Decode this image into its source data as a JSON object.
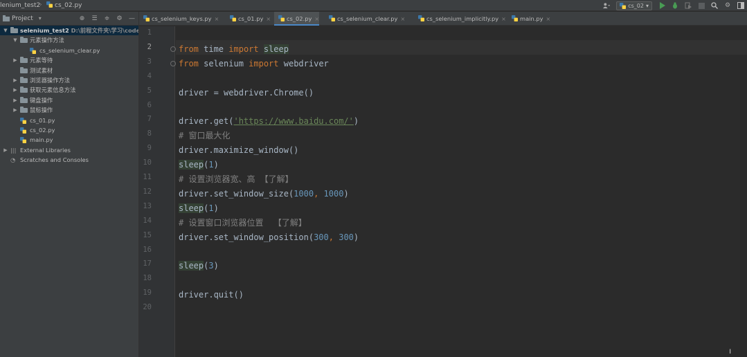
{
  "topbar": {
    "project_crumb": "lenium_test2",
    "file_crumb": "cs_02.py",
    "run_config": "cs_02",
    "icons": [
      "user-icon",
      "run-icon",
      "debug-icon",
      "coverage-icon",
      "stop-icon",
      "search-icon",
      "settings-icon",
      "window-icon"
    ]
  },
  "project_panel": {
    "title": "Project",
    "tree": [
      {
        "label": "selenium_test2",
        "path": "D:\\前程文件夹\\学习\\code\\",
        "type": "root",
        "expanded": true
      },
      {
        "label": "元素操作方法",
        "type": "folder",
        "expanded": true
      },
      {
        "label": "cs_selenium_clear.py",
        "type": "file"
      },
      {
        "label": "元素等待",
        "type": "folder",
        "expanded": false
      },
      {
        "label": "测试素材",
        "type": "folder-leaf"
      },
      {
        "label": "浏览器操作方法",
        "type": "folder",
        "expanded": false
      },
      {
        "label": "获取元素信息方法",
        "type": "folder",
        "expanded": false
      },
      {
        "label": "键盘操作",
        "type": "folder",
        "expanded": false
      },
      {
        "label": "鼠标操作",
        "type": "folder",
        "expanded": false
      },
      {
        "label": "cs_01.py",
        "type": "file"
      },
      {
        "label": "cs_02.py",
        "type": "file"
      },
      {
        "label": "main.py",
        "type": "file"
      },
      {
        "label": "External Libraries",
        "type": "lib",
        "expanded": false
      },
      {
        "label": "Scratches and Consoles",
        "type": "scratch"
      }
    ]
  },
  "tabs": [
    {
      "label": "cs_selenium_keys.py",
      "active": false
    },
    {
      "label": "cs_01.py",
      "active": false
    },
    {
      "label": "cs_02.py",
      "active": true
    },
    {
      "label": "cs_selenium_clear.py",
      "active": false
    },
    {
      "label": "cs_selenium_implicitly.py",
      "active": false
    },
    {
      "label": "main.py",
      "active": false
    }
  ],
  "editor": {
    "current_line": 2,
    "lines": [
      {
        "n": "1",
        "tokens": []
      },
      {
        "n": "2",
        "tokens": [
          {
            "t": "from",
            "c": "kw"
          },
          {
            "t": " time "
          },
          {
            "t": "import",
            "c": "kw"
          },
          {
            "t": " "
          },
          {
            "t": "sleep",
            "c": "hl"
          }
        ]
      },
      {
        "n": "3",
        "tokens": [
          {
            "t": "from",
            "c": "kw"
          },
          {
            "t": " selenium "
          },
          {
            "t": "import",
            "c": "kw"
          },
          {
            "t": " webdriver"
          }
        ]
      },
      {
        "n": "4",
        "tokens": []
      },
      {
        "n": "5",
        "tokens": [
          {
            "t": "driver = webdriver.Chrome()"
          }
        ]
      },
      {
        "n": "6",
        "tokens": []
      },
      {
        "n": "7",
        "tokens": [
          {
            "t": "driver.get("
          },
          {
            "t": "'https://www.baidu.com/'",
            "c": "str"
          },
          {
            "t": ")"
          }
        ]
      },
      {
        "n": "8",
        "tokens": [
          {
            "t": "# 窗口最大化",
            "c": "cmt"
          }
        ]
      },
      {
        "n": "9",
        "tokens": [
          {
            "t": "driver.maximize_window()"
          }
        ]
      },
      {
        "n": "10",
        "tokens": [
          {
            "t": "sleep",
            "c": "hl"
          },
          {
            "t": "("
          },
          {
            "t": "1",
            "c": "num"
          },
          {
            "t": ")"
          }
        ]
      },
      {
        "n": "11",
        "tokens": [
          {
            "t": "# 设置浏览器宽、高 【了解】",
            "c": "cmt"
          }
        ]
      },
      {
        "n": "12",
        "tokens": [
          {
            "t": "driver.set_window_size("
          },
          {
            "t": "1000",
            "c": "num"
          },
          {
            "t": ", ",
            "c": "kw"
          },
          {
            "t": "1000",
            "c": "num"
          },
          {
            "t": ")"
          }
        ]
      },
      {
        "n": "13",
        "tokens": [
          {
            "t": "sleep",
            "c": "hl"
          },
          {
            "t": "("
          },
          {
            "t": "1",
            "c": "num"
          },
          {
            "t": ")"
          }
        ]
      },
      {
        "n": "14",
        "tokens": [
          {
            "t": "# 设置窗口浏览器位置  【了解】",
            "c": "cmt"
          }
        ]
      },
      {
        "n": "15",
        "tokens": [
          {
            "t": "driver.set_window_position("
          },
          {
            "t": "300",
            "c": "num"
          },
          {
            "t": ", ",
            "c": "kw"
          },
          {
            "t": "300",
            "c": "num"
          },
          {
            "t": ")"
          }
        ]
      },
      {
        "n": "16",
        "tokens": []
      },
      {
        "n": "17",
        "tokens": [
          {
            "t": "sleep",
            "c": "hl"
          },
          {
            "t": "("
          },
          {
            "t": "3",
            "c": "num"
          },
          {
            "t": ")"
          }
        ]
      },
      {
        "n": "18",
        "tokens": []
      },
      {
        "n": "19",
        "tokens": [
          {
            "t": "driver.quit()"
          }
        ]
      },
      {
        "n": "20",
        "tokens": []
      }
    ]
  }
}
